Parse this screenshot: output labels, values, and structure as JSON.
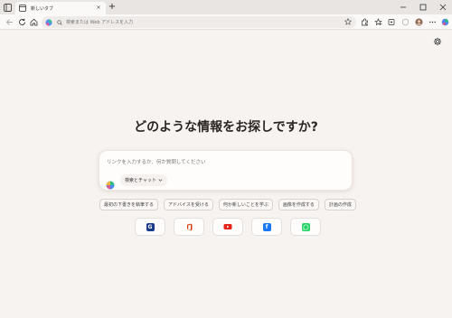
{
  "tab": {
    "title": "新しいタブ",
    "close": "×"
  },
  "new_tab": "+",
  "address": {
    "placeholder": "検索または Web アドレスを入力"
  },
  "main": {
    "heading": "どのような情報をお探しですか?",
    "search_placeholder": "リンクを入力するか、何か質問してください",
    "mode_label": "検索とチャット"
  },
  "chips": [
    {
      "label": "最初の下書きを執筆する"
    },
    {
      "label": "アドバイスを受ける"
    },
    {
      "label": "何か新しいことを学ぶ"
    },
    {
      "label": "画像を作成する"
    },
    {
      "label": "計画の作成"
    }
  ],
  "quick_links": [
    {
      "icon": "google-icon",
      "glyph": "G",
      "color": "#1a3a8a"
    },
    {
      "icon": "office-icon",
      "glyph": "",
      "color": "#d83b01"
    },
    {
      "icon": "youtube-icon",
      "glyph": "",
      "color": "#e62117"
    },
    {
      "icon": "facebook-icon",
      "glyph": "f",
      "color": "#1877f2"
    },
    {
      "icon": "whatsapp-icon",
      "glyph": "",
      "color": "#25d366"
    }
  ]
}
